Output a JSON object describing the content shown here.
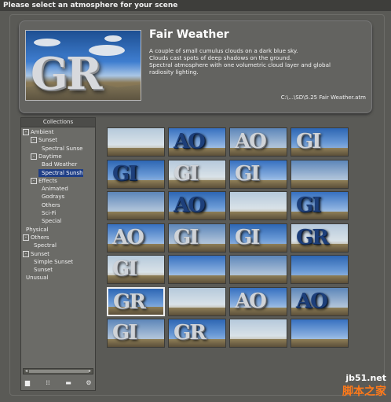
{
  "window": {
    "title": "Please select an atmosphere for your scene"
  },
  "atmosphere": {
    "name": "Fair Weather",
    "description_lines": [
      "A couple of small cumulus clouds on a dark blue sky.",
      "Clouds cast spots of deep shadows on the ground.",
      "Spectral atmosphere with one volumetric cloud layer and global radiosity lighting."
    ],
    "path": "C:\\...\\SD\\5.25 Fair Weather.atm",
    "preview_letters": "GR"
  },
  "collections": {
    "header": "Collections",
    "tree": [
      {
        "label": "Ambient",
        "toggle": "-",
        "level": 0
      },
      {
        "label": "Sunset",
        "toggle": "-",
        "level": 1
      },
      {
        "label": "Spectral Sunse",
        "toggle": "",
        "level": 2
      },
      {
        "label": "Daytime",
        "toggle": "-",
        "level": 1
      },
      {
        "label": "Bad Weather",
        "toggle": "",
        "level": 2
      },
      {
        "label": "Spectral Sunsh",
        "toggle": "",
        "level": 2,
        "selected": true
      },
      {
        "label": "Effects",
        "toggle": "-",
        "level": 1
      },
      {
        "label": "Animated",
        "toggle": "",
        "level": 2
      },
      {
        "label": "Godrays",
        "toggle": "",
        "level": 2
      },
      {
        "label": "Others",
        "toggle": "",
        "level": 2
      },
      {
        "label": "Sci-Fi",
        "toggle": "",
        "level": 2
      },
      {
        "label": "Special",
        "toggle": "",
        "level": 2
      },
      {
        "label": "Physical",
        "toggle": "",
        "level": 0
      },
      {
        "label": "Others",
        "toggle": "-",
        "level": 0
      },
      {
        "label": "Spectral",
        "toggle": "",
        "level": 1
      },
      {
        "label": "Sunset",
        "toggle": "-",
        "level": 0
      },
      {
        "label": "Simple Sunset",
        "toggle": "",
        "level": 1
      },
      {
        "label": "Sunset",
        "toggle": "",
        "level": 1
      },
      {
        "label": "Unusual",
        "toggle": "",
        "level": 0
      }
    ],
    "toolbar_icons": [
      "new-collection-icon",
      "list-icon",
      "folder-icon",
      "settings-icon"
    ]
  },
  "thumbnails": [
    {
      "letters": "",
      "style": "light"
    },
    {
      "letters": "AO",
      "style": "dark"
    },
    {
      "letters": "AO",
      "style": "light"
    },
    {
      "letters": "GI",
      "style": "light"
    },
    {
      "letters": "GI",
      "style": "dark"
    },
    {
      "letters": "GI",
      "style": "light"
    },
    {
      "letters": "GI",
      "style": "light"
    },
    {
      "letters": "",
      "style": "light"
    },
    {
      "letters": "",
      "style": "light"
    },
    {
      "letters": "AO",
      "style": "dark"
    },
    {
      "letters": "",
      "style": "light"
    },
    {
      "letters": "GI",
      "style": "dark"
    },
    {
      "letters": "AO",
      "style": "light"
    },
    {
      "letters": "GI",
      "style": "light"
    },
    {
      "letters": "GI",
      "style": "light"
    },
    {
      "letters": "GR",
      "style": "dark"
    },
    {
      "letters": "GI",
      "style": "light"
    },
    {
      "letters": "",
      "style": "light"
    },
    {
      "letters": "",
      "style": "light"
    },
    {
      "letters": "",
      "style": "light"
    },
    {
      "letters": "GR",
      "style": "light",
      "selected": true
    },
    {
      "letters": "",
      "style": "light"
    },
    {
      "letters": "AO",
      "style": "light"
    },
    {
      "letters": "AO",
      "style": "dark"
    },
    {
      "letters": "GI",
      "style": "light"
    },
    {
      "letters": "GR",
      "style": "light"
    },
    {
      "letters": "",
      "style": "light"
    },
    {
      "letters": "",
      "style": "dark"
    }
  ],
  "watermark": {
    "url": "jb51.net",
    "text": "脚本之家"
  }
}
